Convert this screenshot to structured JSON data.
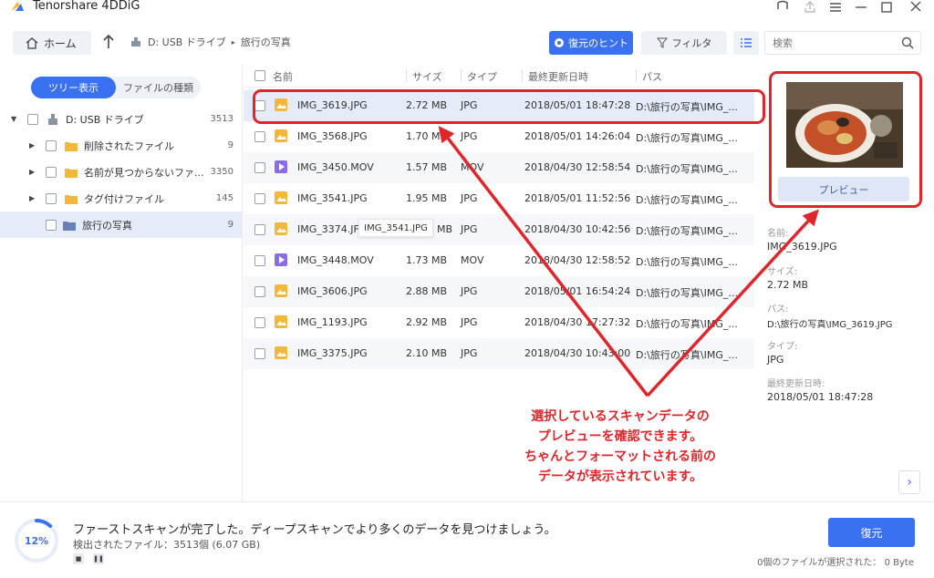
{
  "app": {
    "title": "Tenorshare 4DDiG"
  },
  "toolbar": {
    "home_label": "ホーム",
    "path": [
      "D: USB ドライブ",
      "旅行の写真"
    ],
    "hint_label": "復元のヒント",
    "filter_label": "フィルタ",
    "search_placeholder": "検索"
  },
  "sidebar": {
    "toggle": [
      "ツリー表示",
      "ファイルの種類"
    ],
    "tree": [
      {
        "label": "D: USB ドライブ",
        "count": "3513"
      },
      {
        "label": "削除されたファイル",
        "count": "9"
      },
      {
        "label": "名前が見つからないファ...",
        "count": "3350"
      },
      {
        "label": "タグ付けファイル",
        "count": "145"
      },
      {
        "label": "旅行の写真",
        "count": "9"
      }
    ]
  },
  "table": {
    "headers": [
      "名前",
      "サイズ",
      "タイプ",
      "最終更新日時",
      "パス"
    ],
    "rows": [
      {
        "name": "IMG_3619.JPG",
        "size": "2.72 MB",
        "type": "JPG",
        "date": "2018/05/01 18:47:28",
        "path": "D:\\旅行の写真\\IMG_..."
      },
      {
        "name": "IMG_3568.JPG",
        "size": "1.70 MB",
        "type": "JPG",
        "date": "2018/05/01 14:26:04",
        "path": "D:\\旅行の写真\\IMG_..."
      },
      {
        "name": "IMG_3450.MOV",
        "size": "1.57 MB",
        "type": "MOV",
        "date": "2018/04/30 12:58:54",
        "path": "D:\\旅行の写真\\IMG_..."
      },
      {
        "name": "IMG_3541.JPG",
        "size": "1.95 MB",
        "type": "JPG",
        "date": "2018/05/01 11:52:56",
        "path": "D:\\旅行の写真\\IMG_..."
      },
      {
        "name": "IMG_3374.JF",
        "size": "MB",
        "type": "JPG",
        "date": "2018/04/30 10:42:56",
        "path": "D:\\旅行の写真\\IMG_..."
      },
      {
        "name": "IMG_3448.MOV",
        "size": "1.73 MB",
        "type": "MOV",
        "date": "2018/04/30 12:58:52",
        "path": "D:\\旅行の写真\\IMG_..."
      },
      {
        "name": "IMG_3606.JPG",
        "size": "2.88 MB",
        "type": "JPG",
        "date": "2018/05/01 16:54:24",
        "path": "D:\\旅行の写真\\IMG_..."
      },
      {
        "name": "IMG_1193.JPG",
        "size": "2.92 MB",
        "type": "JPG",
        "date": "2018/04/30 17:27:32",
        "path": "D:\\旅行の写真\\IMG_..."
      },
      {
        "name": "IMG_3375.JPG",
        "size": "2.10 MB",
        "type": "JPG",
        "date": "2018/04/30 10:43:00",
        "path": "D:\\旅行の写真\\IMG_..."
      }
    ],
    "tooltip": "IMG_3541.JPG"
  },
  "preview": {
    "button_label": "プレビュー",
    "labels": [
      "名前:",
      "サイズ:",
      "パス:",
      "タイプ:",
      "最終更新日時:"
    ],
    "values": [
      "IMG_3619.JPG",
      "2.72 MB",
      "D:\\旅行の写真\\IMG_3619.JPG",
      "JPG",
      "2018/05/01 18:47:28"
    ]
  },
  "annotation": {
    "lines": [
      "選択しているスキャンデータの",
      "プレビューを確認できます。",
      "ちゃんとフォーマットされる前の",
      "データが表示されています。"
    ]
  },
  "status": {
    "progress_text": "12%",
    "progress_value": 0.12,
    "message": "ファーストスキャンが完了した。ディープスキャンでより多くのデータを見つけましょう。",
    "found": "検出されたファイル：3513個 (6.07 GB)",
    "recover_label": "復元",
    "selected_info": "0個のファイルが選択された： 0 Byte"
  },
  "colors": {
    "accent": "#3a71f0",
    "annotation": "#e0262a",
    "folder": "#f5b73a",
    "video": "#8c6be8"
  }
}
